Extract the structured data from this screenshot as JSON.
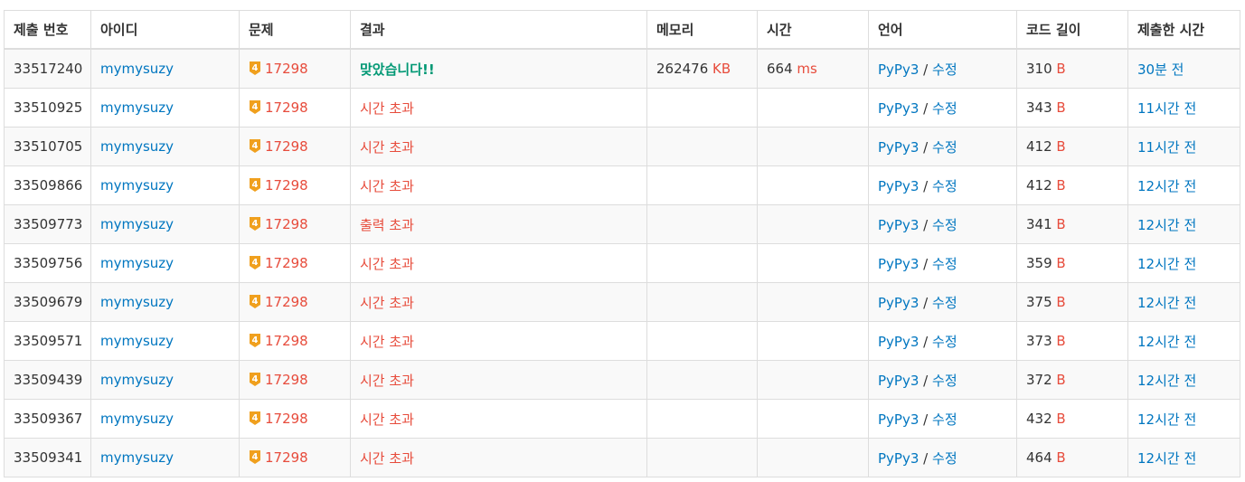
{
  "headers": [
    "제출 번호",
    "아이디",
    "문제",
    "결과",
    "메모리",
    "시간",
    "언어",
    "코드 길이",
    "제출한 시간"
  ],
  "colors": {
    "link": "#0076c0",
    "error": "#e74c3c",
    "accepted": "#009874",
    "tier_badge": "#f0a01e"
  },
  "rows": [
    {
      "id": "33517240",
      "user": "mymysuzy",
      "tier_icon": "gold-4-tier-icon",
      "tier_num": "4",
      "problem": "17298",
      "result": "맞았습니다!!",
      "result_type": "accepted",
      "memory": "262476",
      "memory_unit": "KB",
      "time": "664",
      "time_unit": "ms",
      "lang": "PyPy3",
      "sep": "/",
      "edit": "수정",
      "code_len": "310",
      "code_unit": "B",
      "submitted": "30분 전"
    },
    {
      "id": "33510925",
      "user": "mymysuzy",
      "tier_icon": "gold-4-tier-icon",
      "tier_num": "4",
      "problem": "17298",
      "result": "시간 초과",
      "result_type": "error",
      "memory": "",
      "memory_unit": "",
      "time": "",
      "time_unit": "",
      "lang": "PyPy3",
      "sep": "/",
      "edit": "수정",
      "code_len": "343",
      "code_unit": "B",
      "submitted": "11시간 전"
    },
    {
      "id": "33510705",
      "user": "mymysuzy",
      "tier_icon": "gold-4-tier-icon",
      "tier_num": "4",
      "problem": "17298",
      "result": "시간 초과",
      "result_type": "error",
      "memory": "",
      "memory_unit": "",
      "time": "",
      "time_unit": "",
      "lang": "PyPy3",
      "sep": "/",
      "edit": "수정",
      "code_len": "412",
      "code_unit": "B",
      "submitted": "11시간 전"
    },
    {
      "id": "33509866",
      "user": "mymysuzy",
      "tier_icon": "gold-4-tier-icon",
      "tier_num": "4",
      "problem": "17298",
      "result": "시간 초과",
      "result_type": "error",
      "memory": "",
      "memory_unit": "",
      "time": "",
      "time_unit": "",
      "lang": "PyPy3",
      "sep": "/",
      "edit": "수정",
      "code_len": "412",
      "code_unit": "B",
      "submitted": "12시간 전"
    },
    {
      "id": "33509773",
      "user": "mymysuzy",
      "tier_icon": "gold-4-tier-icon",
      "tier_num": "4",
      "problem": "17298",
      "result": "출력 초과",
      "result_type": "error",
      "memory": "",
      "memory_unit": "",
      "time": "",
      "time_unit": "",
      "lang": "PyPy3",
      "sep": "/",
      "edit": "수정",
      "code_len": "341",
      "code_unit": "B",
      "submitted": "12시간 전"
    },
    {
      "id": "33509756",
      "user": "mymysuzy",
      "tier_icon": "gold-4-tier-icon",
      "tier_num": "4",
      "problem": "17298",
      "result": "시간 초과",
      "result_type": "error",
      "memory": "",
      "memory_unit": "",
      "time": "",
      "time_unit": "",
      "lang": "PyPy3",
      "sep": "/",
      "edit": "수정",
      "code_len": "359",
      "code_unit": "B",
      "submitted": "12시간 전"
    },
    {
      "id": "33509679",
      "user": "mymysuzy",
      "tier_icon": "gold-4-tier-icon",
      "tier_num": "4",
      "problem": "17298",
      "result": "시간 초과",
      "result_type": "error",
      "memory": "",
      "memory_unit": "",
      "time": "",
      "time_unit": "",
      "lang": "PyPy3",
      "sep": "/",
      "edit": "수정",
      "code_len": "375",
      "code_unit": "B",
      "submitted": "12시간 전"
    },
    {
      "id": "33509571",
      "user": "mymysuzy",
      "tier_icon": "gold-4-tier-icon",
      "tier_num": "4",
      "problem": "17298",
      "result": "시간 초과",
      "result_type": "error",
      "memory": "",
      "memory_unit": "",
      "time": "",
      "time_unit": "",
      "lang": "PyPy3",
      "sep": "/",
      "edit": "수정",
      "code_len": "373",
      "code_unit": "B",
      "submitted": "12시간 전"
    },
    {
      "id": "33509439",
      "user": "mymysuzy",
      "tier_icon": "gold-4-tier-icon",
      "tier_num": "4",
      "problem": "17298",
      "result": "시간 초과",
      "result_type": "error",
      "memory": "",
      "memory_unit": "",
      "time": "",
      "time_unit": "",
      "lang": "PyPy3",
      "sep": "/",
      "edit": "수정",
      "code_len": "372",
      "code_unit": "B",
      "submitted": "12시간 전"
    },
    {
      "id": "33509367",
      "user": "mymysuzy",
      "tier_icon": "gold-4-tier-icon",
      "tier_num": "4",
      "problem": "17298",
      "result": "시간 초과",
      "result_type": "error",
      "memory": "",
      "memory_unit": "",
      "time": "",
      "time_unit": "",
      "lang": "PyPy3",
      "sep": "/",
      "edit": "수정",
      "code_len": "432",
      "code_unit": "B",
      "submitted": "12시간 전"
    },
    {
      "id": "33509341",
      "user": "mymysuzy",
      "tier_icon": "gold-4-tier-icon",
      "tier_num": "4",
      "problem": "17298",
      "result": "시간 초과",
      "result_type": "error",
      "memory": "",
      "memory_unit": "",
      "time": "",
      "time_unit": "",
      "lang": "PyPy3",
      "sep": "/",
      "edit": "수정",
      "code_len": "464",
      "code_unit": "B",
      "submitted": "12시간 전"
    }
  ]
}
